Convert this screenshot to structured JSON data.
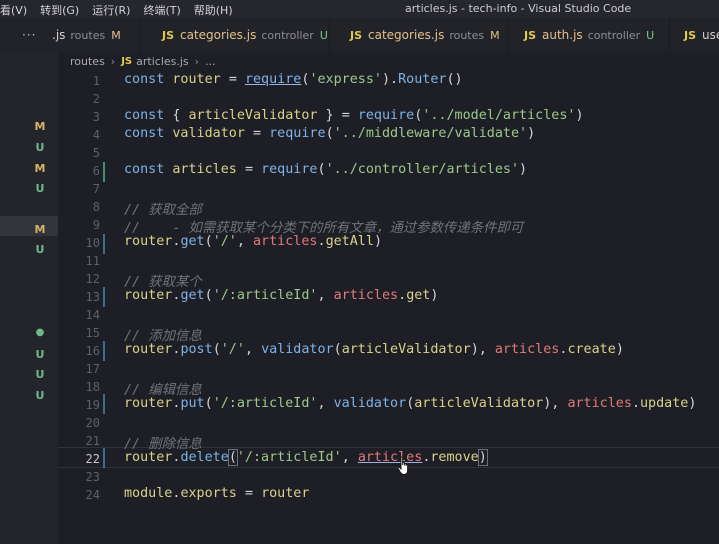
{
  "menu": [
    "看(V)",
    "转到(G)",
    "运行(R)",
    "终端(T)",
    "帮助(H)"
  ],
  "window_title": "articles.js - tech-info - Visual Studio Code",
  "tabs": [
    {
      "name": ".js",
      "dir": "routes",
      "status": "M"
    },
    {
      "name": "categories.js",
      "dir": "controller",
      "status": "U"
    },
    {
      "name": "categories.js",
      "dir": "routes",
      "status": "M"
    },
    {
      "name": "auth.js",
      "dir": "controller",
      "status": "U"
    },
    {
      "name": "use"
    }
  ],
  "tab_file_badge": "JS",
  "tab_more": "···",
  "breadcrumb": {
    "folder": "routes",
    "file": "articles.js",
    "symbol": "...",
    "badge": "JS"
  },
  "explorer_status": [
    "M",
    "U",
    "M",
    "U",
    "M",
    "U",
    "U",
    "U",
    "U"
  ],
  "line_numbers": [
    "1",
    "2",
    "3",
    "4",
    "5",
    "6",
    "7",
    "8",
    "9",
    "10",
    "11",
    "12",
    "13",
    "14",
    "15",
    "16",
    "17",
    "18",
    "19",
    "20",
    "21",
    "22",
    "23",
    "24"
  ],
  "current_line": "22",
  "code": {
    "l1": [
      "const",
      "router",
      "=",
      "require",
      "(",
      "'express'",
      ").",
      "Router",
      "()"
    ],
    "l3": [
      "const",
      "{ ",
      "articleValidator",
      " }",
      "=",
      "require",
      "(",
      "'../model/articles'",
      ")"
    ],
    "l4": [
      "const",
      "validator",
      "=",
      "require",
      "(",
      "'../middleware/validate'",
      ")"
    ],
    "l6": [
      "const",
      "articles",
      "=",
      "require",
      "(",
      "'../controller/articles'",
      ")"
    ],
    "l8": "// 获取全部",
    "l9": "//    - 如需获取某个分类下的所有文章，通过参数传递条件即可",
    "l10": [
      "router",
      ".",
      "get",
      "(",
      "'/'",
      ", ",
      "articles",
      ".",
      "getAll",
      ")"
    ],
    "l12": "// 获取某个",
    "l13": [
      "router",
      ".",
      "get",
      "(",
      "'/:articleId'",
      ", ",
      "articles",
      ".",
      "get",
      ")"
    ],
    "l15": "// 添加信息",
    "l16": [
      "router",
      ".",
      "post",
      "(",
      "'/'",
      ", ",
      "validator",
      "(",
      "articleValidator",
      "), ",
      "articles",
      ".",
      "create",
      ")"
    ],
    "l18": "// 编辑信息",
    "l19": [
      "router",
      ".",
      "put",
      "(",
      "'/:articleId'",
      ", ",
      "validator",
      "(",
      "articleValidator",
      "), ",
      "articles",
      ".",
      "update",
      ")"
    ],
    "l21": "// 删除信息",
    "l22": [
      "router",
      ".",
      "delete",
      "(",
      "'/:articleId'",
      ", ",
      "articles",
      ".",
      "remove",
      ")"
    ],
    "l24": [
      "module",
      ".",
      "exports",
      "=",
      "router"
    ]
  },
  "colors": {
    "keyword": "#7fb2e6",
    "variable": "#d8d28a",
    "string": "#9cc98a",
    "property": "#e07a7a",
    "comment": "#70737c",
    "modified": "#d7b36b",
    "untracked": "#6fb98f"
  }
}
